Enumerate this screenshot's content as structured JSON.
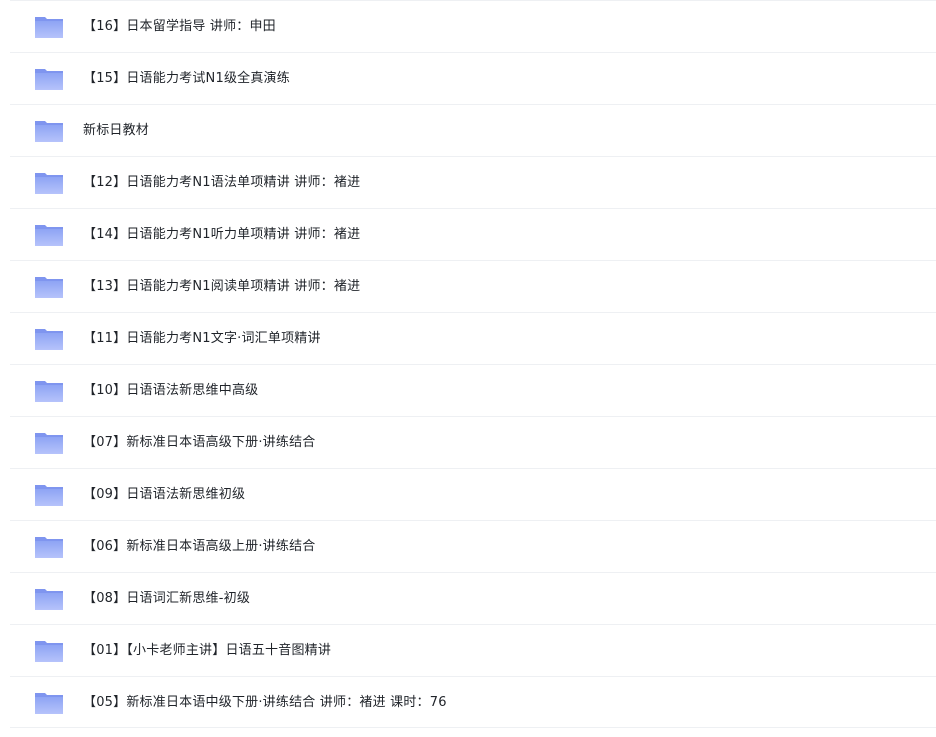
{
  "colors": {
    "folder_top": "#8ea4f4",
    "folder_bottom": "#b6c3fb",
    "folder_tab": "#7f95ef",
    "divider": "#eef0f3",
    "text": "#1f2329"
  },
  "folders": [
    {
      "name": "【16】日本留学指导 讲师：申田",
      "icon": "folder-icon"
    },
    {
      "name": "【15】日语能力考试N1级全真演练",
      "icon": "folder-icon"
    },
    {
      "name": "新标日教材",
      "icon": "folder-icon"
    },
    {
      "name": "【12】日语能力考N1语法单项精讲 讲师：褚进",
      "icon": "folder-icon"
    },
    {
      "name": "【14】日语能力考N1听力单项精讲 讲师：褚进",
      "icon": "folder-icon"
    },
    {
      "name": "【13】日语能力考N1阅读单项精讲 讲师：褚进",
      "icon": "folder-icon"
    },
    {
      "name": "【11】日语能力考N1文字·词汇单项精讲",
      "icon": "folder-icon"
    },
    {
      "name": "【10】日语语法新思维中高级",
      "icon": "folder-icon"
    },
    {
      "name": "【07】新标准日本语高级下册·讲练结合",
      "icon": "folder-icon"
    },
    {
      "name": "【09】日语语法新思维初级",
      "icon": "folder-icon"
    },
    {
      "name": "【06】新标准日本语高级上册·讲练结合",
      "icon": "folder-icon"
    },
    {
      "name": "【08】日语词汇新思维-初级",
      "icon": "folder-icon"
    },
    {
      "name": "【01】【小卡老师主讲】日语五十音图精讲",
      "icon": "folder-icon"
    },
    {
      "name": "【05】新标准日本语中级下册·讲练结合 讲师：褚进 课时：76",
      "icon": "folder-icon"
    }
  ]
}
